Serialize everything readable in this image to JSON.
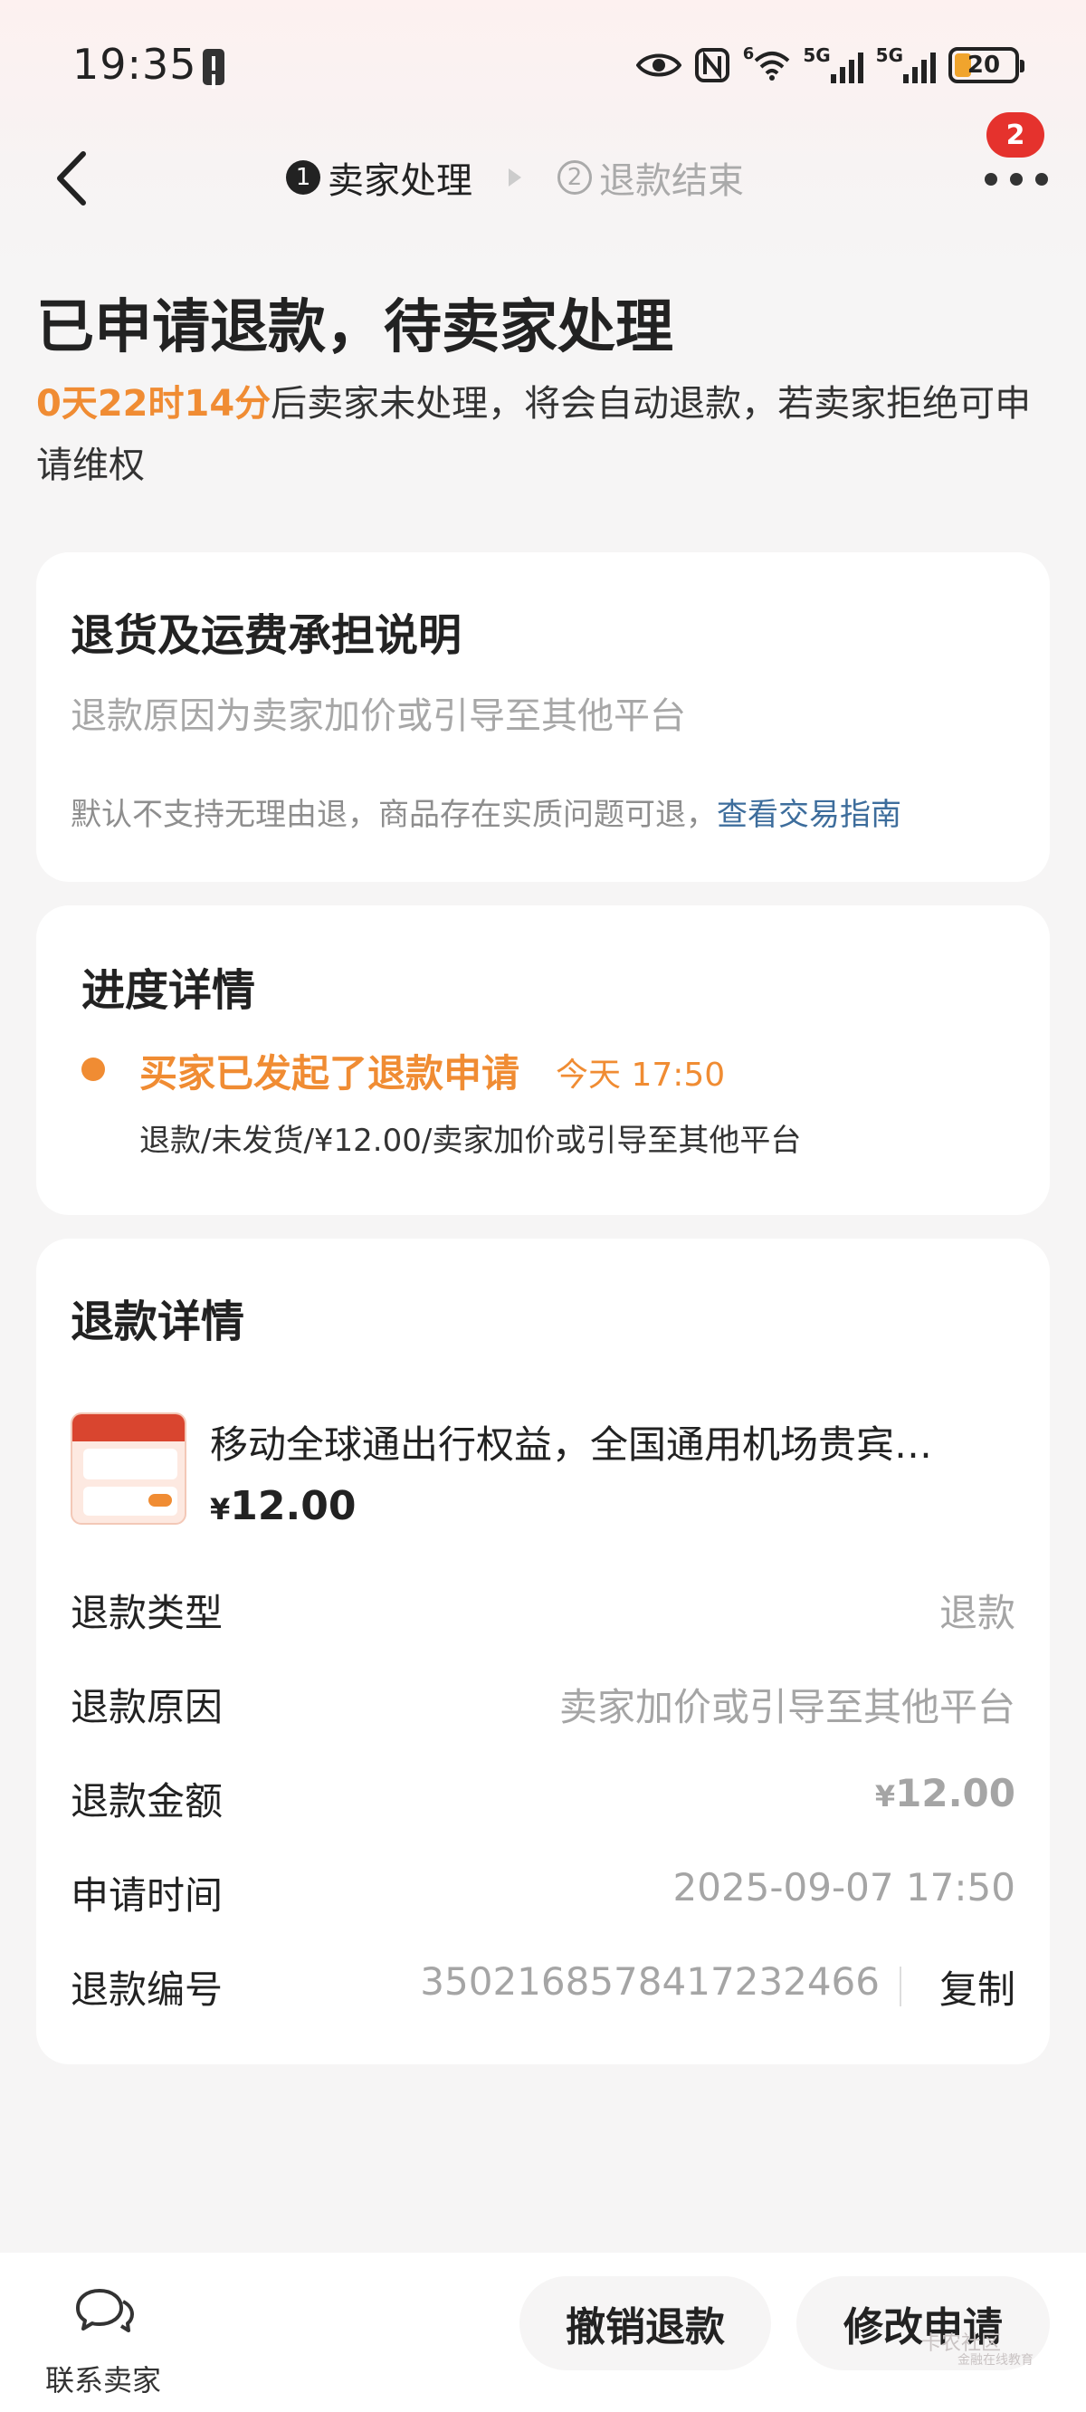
{
  "status_bar": {
    "time": "19:35",
    "network_label_1": "5G",
    "network_label_2": "5G",
    "wifi_label": "6",
    "battery": "20"
  },
  "nav": {
    "steps": [
      {
        "num": "1",
        "label": "卖家处理"
      },
      {
        "num": "2",
        "label": "退款结束"
      }
    ],
    "badge_count": "2"
  },
  "header": {
    "title": "已申请退款，待卖家处理",
    "countdown": "0天22时14分",
    "countdown_text": "后卖家未处理，将会自动退款，若卖家拒绝可申请维权"
  },
  "policy_card": {
    "title": "退货及运费承担说明",
    "reason": "退款原因为卖家加价或引导至其他平台",
    "note": "默认不支持无理由退，商品存在实质问题可退，",
    "link": "查看交易指南"
  },
  "progress_card": {
    "title": "进度详情",
    "event": "买家已发起了退款申请",
    "event_time": "今天 17:50",
    "detail": "退款/未发货/¥12.00/卖家加价或引导至其他平台"
  },
  "refund_card": {
    "title": "退款详情",
    "product": {
      "name": "移动全球通出行权益，全国通用机场贵宾…",
      "currency": "¥",
      "price": "12.00"
    },
    "rows": [
      {
        "label": "退款类型",
        "value": "退款"
      },
      {
        "label": "退款原因",
        "value": "卖家加价或引导至其他平台"
      },
      {
        "label": "退款金额",
        "currency": "¥",
        "value": "12.00"
      },
      {
        "label": "申请时间",
        "value": "2025-09-07 17:50"
      },
      {
        "label": "退款编号",
        "value": "3502168578417232466"
      }
    ],
    "copy_label": "复制"
  },
  "bottom_bar": {
    "contact_label": "联系卖家",
    "cancel_label": "撤销退款",
    "modify_label": "修改申请"
  },
  "watermark": {
    "text": "卡农社区",
    "sub": "金融在线教育"
  },
  "colors": {
    "accent": "#f08c33",
    "link": "#3d6d9c",
    "badge": "#e5322d"
  }
}
